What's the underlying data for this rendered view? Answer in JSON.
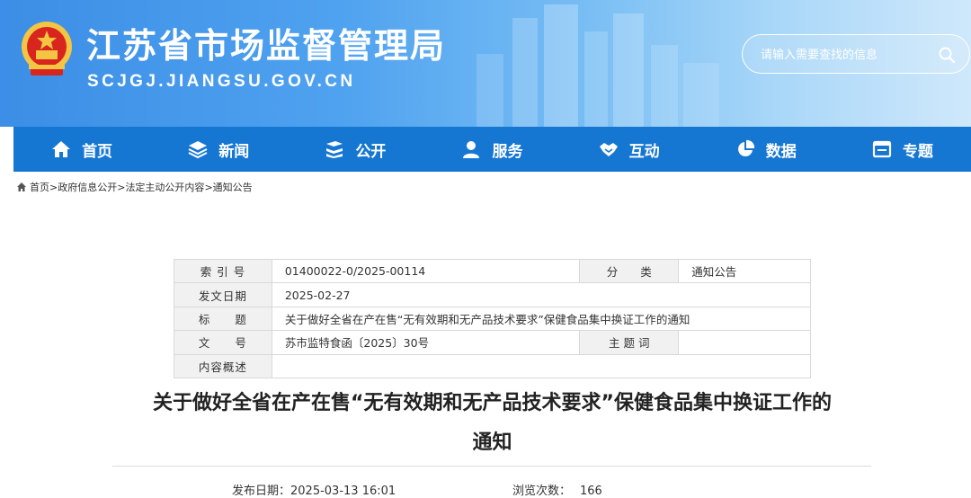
{
  "header": {
    "title": "江苏省市场监督管理局",
    "domain": "SCJGJ.JIANGSU.GOV.CN",
    "search_placeholder": "请输入需要查找的信息"
  },
  "nav": [
    {
      "label": "首页",
      "icon": "home-icon"
    },
    {
      "label": "新闻",
      "icon": "layers-icon"
    },
    {
      "label": "公开",
      "icon": "stack-icon"
    },
    {
      "label": "服务",
      "icon": "user-icon"
    },
    {
      "label": "互动",
      "icon": "handshake-icon"
    },
    {
      "label": "数据",
      "icon": "pie-chart-icon"
    },
    {
      "label": "专题",
      "icon": "window-icon"
    }
  ],
  "breadcrumb": [
    "首页",
    "政府信息公开",
    "法定主动公开内容",
    "通知公告"
  ],
  "info": {
    "index_label": "索 引 号",
    "index_value": "01400022-0/2025-00114",
    "category_label": "分　　类",
    "category_value": "通知公告",
    "date_label": "发文日期",
    "date_value": "2025-02-27",
    "title_label": "标　　题",
    "title_value": "关于做好全省在产在售“无有效期和无产品技术要求”保健食品集中换证工作的通知",
    "doc_label": "文　　号",
    "doc_value": "苏市监特食函〔2025〕30号",
    "subject_label": "主 题 词",
    "subject_value": "",
    "summary_label": "内容概述",
    "summary_value": ""
  },
  "article": {
    "title_line1": "关于做好全省在产在售“无有效期和无产品技术要求”保健食品集中换证工作的",
    "title_line2": "通知",
    "publish_label": "发布日期：",
    "publish_value": "2025-03-13 16:01",
    "views_label": "浏览次数：",
    "views_value": "166"
  },
  "colors": {
    "nav_bg": "#1677d2",
    "header_start": "#3c8ee6",
    "header_end": "#cfe8fb"
  }
}
